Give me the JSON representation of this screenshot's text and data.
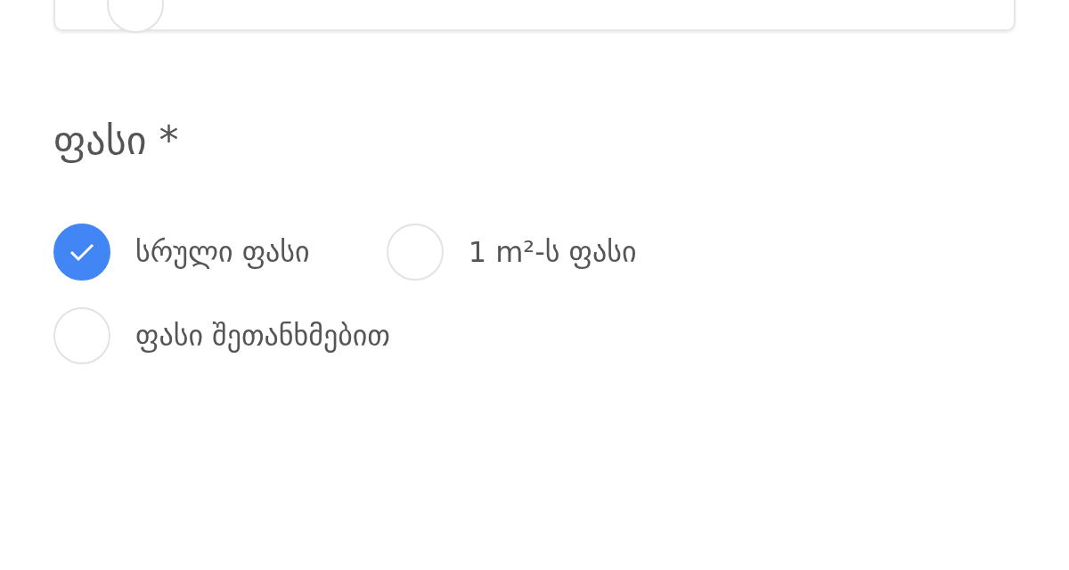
{
  "previous_group": {
    "options": [
      {
        "selected": false
      }
    ]
  },
  "price": {
    "heading": "ფასი *",
    "options": [
      {
        "label": "სრული ფასი",
        "selected": true
      },
      {
        "label": "1 m²-ს ფასი",
        "selected": false
      },
      {
        "label": "ფასი შეთანხმებით",
        "selected": false
      }
    ]
  }
}
